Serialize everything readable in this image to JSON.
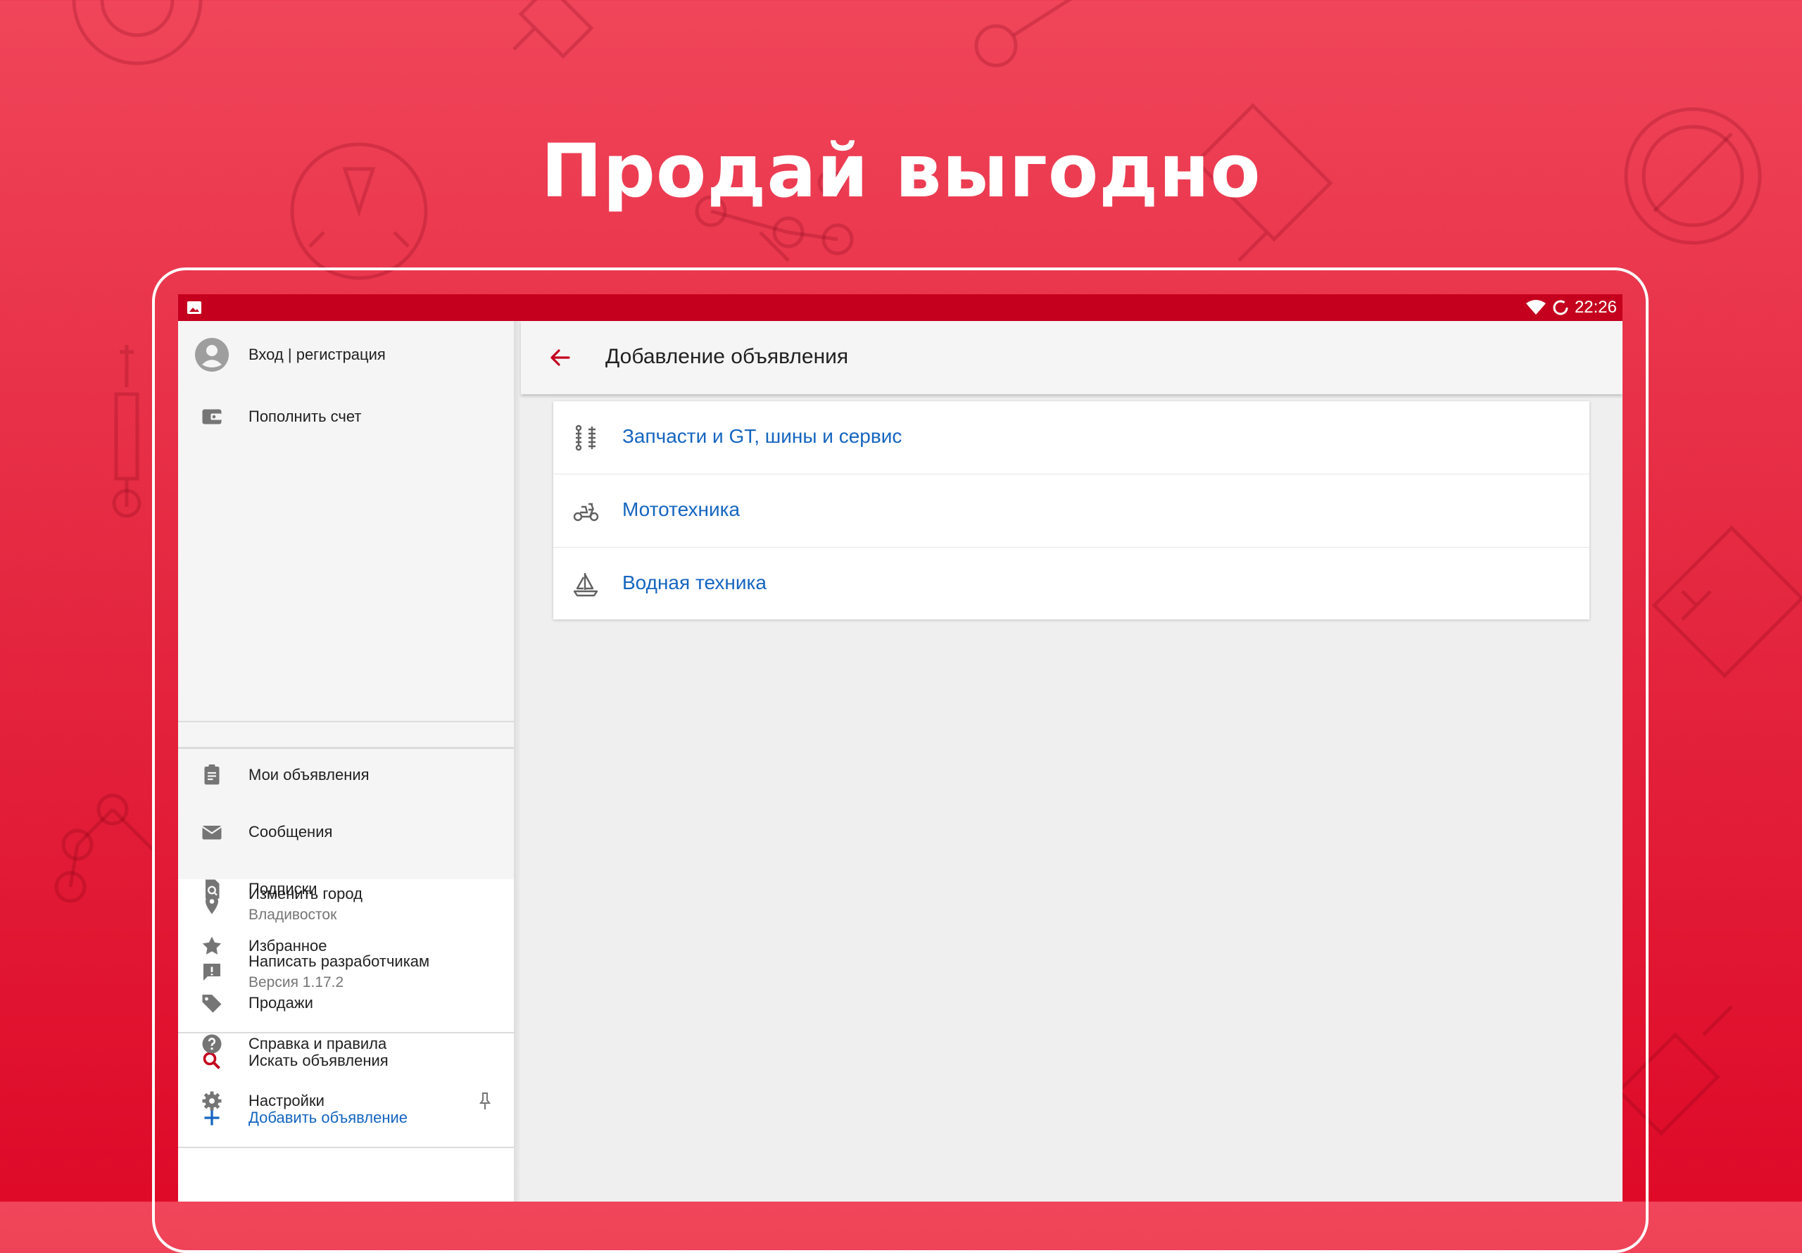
{
  "headline": "Продай выгодно",
  "status_bar": {
    "time": "22:26",
    "icons": [
      "image-icon",
      "wifi-icon",
      "sync-icon"
    ]
  },
  "drawer": {
    "account": {
      "label": "Вход | регистрация",
      "icon": "account-circle-icon"
    },
    "top_up": {
      "label": "Пополнить счет",
      "icon": "wallet-icon"
    },
    "items": [
      {
        "label": "Мои объявления",
        "icon": "clipboard-icon"
      },
      {
        "label": "Сообщения",
        "icon": "mail-icon"
      },
      {
        "label": "Подписки",
        "icon": "subscription-search-icon"
      },
      {
        "label": "Избранное",
        "icon": "star-icon"
      },
      {
        "label": "Продажи",
        "icon": "tag-icon"
      }
    ],
    "actions": [
      {
        "label": "Искать объявления",
        "icon": "search-icon",
        "accent": "#c4001e"
      },
      {
        "label": "Добавить объявление",
        "icon": "plus-icon",
        "accent": "#1565c0"
      }
    ],
    "city": {
      "label": "Изменить город",
      "value": "Владивосток",
      "icon": "location-pin-icon"
    },
    "feedback": {
      "label": "Написать разработчикам",
      "value": "Версия 1.17.2",
      "icon": "feedback-icon"
    },
    "help": {
      "label": "Справка и правила",
      "icon": "help-icon"
    },
    "settings": {
      "label": "Настройки",
      "icon": "gear-icon",
      "pin_icon": "pin-icon"
    }
  },
  "toolbar": {
    "title": "Добавление объявления",
    "back_icon": "arrow-back-icon"
  },
  "categories": [
    {
      "label": "Запчасти и GT, шины и сервис",
      "icon": "shock-absorber-icon"
    },
    {
      "label": "Мототехника",
      "icon": "scooter-icon"
    },
    {
      "label": "Водная техника",
      "icon": "sailboat-icon"
    }
  ],
  "colors": {
    "brand_red": "#c4001e",
    "link_blue": "#1565c0",
    "background_red": "#e52a42"
  }
}
